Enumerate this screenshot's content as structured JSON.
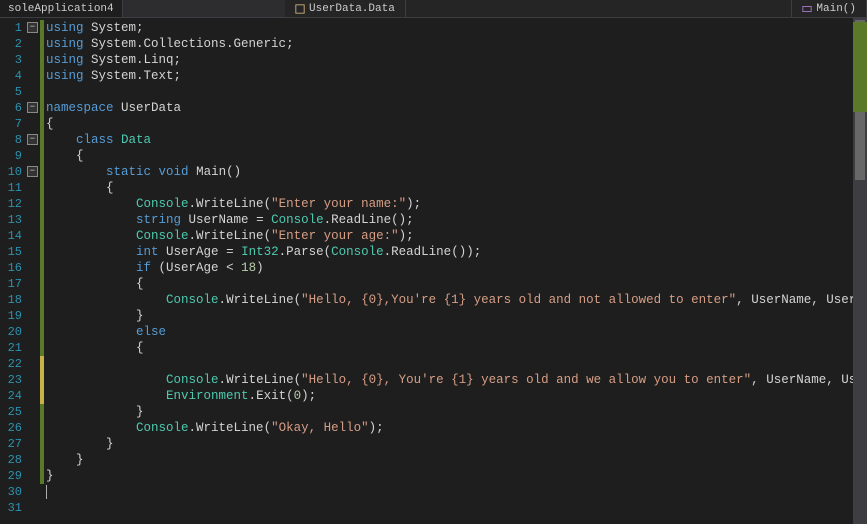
{
  "tab": {
    "title": "soleApplication4"
  },
  "breadcrumbs": {
    "context": "UserData.Data",
    "member": "Main()"
  },
  "lineNumbers": [
    "1",
    "2",
    "3",
    "4",
    "5",
    "6",
    "7",
    "8",
    "9",
    "10",
    "11",
    "12",
    "13",
    "14",
    "15",
    "16",
    "17",
    "18",
    "19",
    "20",
    "21",
    "22",
    "23",
    "24",
    "25",
    "26",
    "27",
    "28",
    "29",
    "30",
    "31"
  ],
  "folds": [
    {
      "line": 1,
      "glyph": "−"
    },
    {
      "line": 6,
      "glyph": "−"
    },
    {
      "line": 8,
      "glyph": "−"
    },
    {
      "line": 10,
      "glyph": "−"
    }
  ],
  "changeBars": [
    {
      "from": 1,
      "to": 29,
      "cls": "green"
    },
    {
      "from": 22,
      "to": 24,
      "cls": "yellow"
    }
  ],
  "code": {
    "l1": {
      "kw1": "using",
      "id": "System",
      "sc": ";"
    },
    "l2": {
      "kw1": "using",
      "id": "System.Collections.Generic",
      "sc": ";"
    },
    "l3": {
      "kw1": "using",
      "id": "System.Linq",
      "sc": ";"
    },
    "l4": {
      "kw1": "using",
      "id": "System.Text",
      "sc": ";"
    },
    "l6": {
      "kw1": "namespace",
      "id": "UserData"
    },
    "l7": {
      "br": "{"
    },
    "l8": {
      "kw1": "class",
      "t": "Data"
    },
    "l9": {
      "br": "{"
    },
    "l10": {
      "kw1": "static",
      "kw2": "void",
      "m": "Main",
      "par": "()"
    },
    "l11": {
      "br": "{"
    },
    "l12": {
      "t": "Console",
      "dot": ".",
      "m": "WriteLine",
      "lp": "(",
      "s": "\"Enter your name:\"",
      "rp": ");"
    },
    "l13": {
      "kw1": "string",
      "id": "UserName",
      "eq": " = ",
      "t": "Console",
      "dot": ".",
      "m": "ReadLine",
      "lp": "(",
      "rp": ");"
    },
    "l14": {
      "t": "Console",
      "dot": ".",
      "m": "WriteLine",
      "lp": "(",
      "s": "\"Enter your age:\"",
      "rp": ");"
    },
    "l15": {
      "kw1": "int",
      "id": "UserAge",
      "eq": " = ",
      "t": "Int32",
      "dot": ".",
      "m": "Parse",
      "lp": "(",
      "t2": "Console",
      "dot2": ".",
      "m2": "ReadLine",
      "inner": "()",
      "rp": ");"
    },
    "l16": {
      "kw1": "if",
      "lp": " (",
      "id": "UserAge",
      "op": " < ",
      "n": "18",
      "rp": ")"
    },
    "l17": {
      "br": "{"
    },
    "l18": {
      "t": "Console",
      "dot": ".",
      "m": "WriteLine",
      "lp": "(",
      "s": "\"Hello, {0},You're {1} years old and not allowed to enter\"",
      "c": ", ",
      "a1": "UserName",
      "c2": ", ",
      "a2": "UserAge",
      "rp": ");"
    },
    "l19": {
      "br": "}"
    },
    "l20": {
      "kw1": "else"
    },
    "l21": {
      "br": "{"
    },
    "l23": {
      "t": "Console",
      "dot": ".",
      "m": "WriteLine",
      "lp": "(",
      "s": "\"Hello, {0}, You're {1} years old and we allow you to enter\"",
      "c": ", ",
      "a1": "UserName",
      "c2": ", ",
      "a2": "UserAge",
      "rp": ");"
    },
    "l24": {
      "t": "Environment",
      "dot": ".",
      "m": "Exit",
      "lp": "(",
      "n": "0",
      "rp": ");"
    },
    "l25": {
      "br": "}"
    },
    "l26": {
      "t": "Console",
      "dot": ".",
      "m": "WriteLine",
      "lp": "(",
      "s": "\"Okay, Hello\"",
      "rp": ");"
    },
    "l27": {
      "br": "}"
    },
    "l28": {
      "br": "}"
    },
    "l29": {
      "br": "}"
    }
  }
}
